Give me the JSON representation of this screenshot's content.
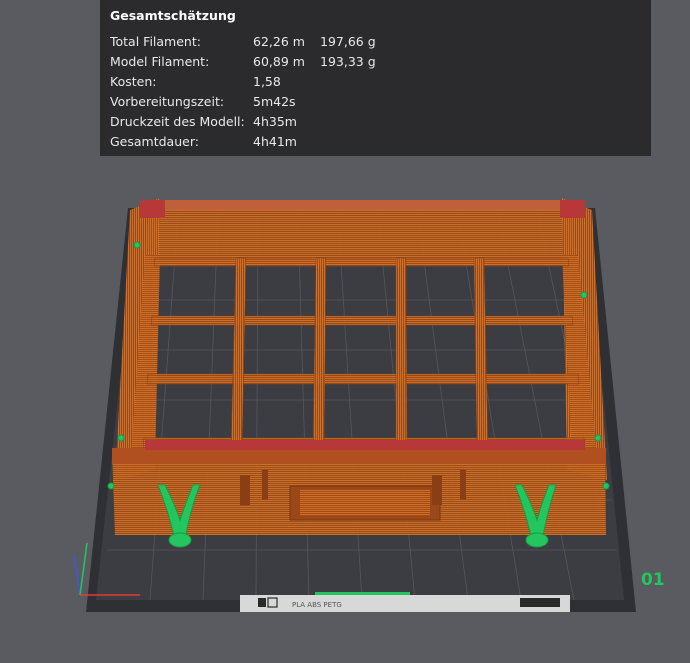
{
  "estimate": {
    "title": "Gesamtschätzung",
    "rows": [
      {
        "label": "Total Filament:",
        "value1": "62,26 m",
        "value2": "197,66 g"
      },
      {
        "label": "Model Filament:",
        "value1": "60,89 m",
        "value2": "193,33 g"
      },
      {
        "label": "Kosten:",
        "value1": "1,58",
        "value2": ""
      },
      {
        "label": "Vorbereitungszeit:",
        "value1": "5m42s",
        "value2": ""
      },
      {
        "label": "Druckzeit des Modell:",
        "value1": "4h35m",
        "value2": ""
      },
      {
        "label": "Gesamtdauer:",
        "value1": "4h41m",
        "value2": ""
      }
    ]
  },
  "plate": {
    "number": "01",
    "label_text": "PLA ABS PETG"
  },
  "colors": {
    "background": "#5a5b60",
    "panel": "#2b2b2e",
    "bed": "#3a3b40",
    "model": "#c8651e",
    "supports": "#22c55e",
    "accent_red": "#b8383a"
  },
  "icons": [
    "qr-code-icon",
    "bed-sticker-icon",
    "layout-icon"
  ]
}
